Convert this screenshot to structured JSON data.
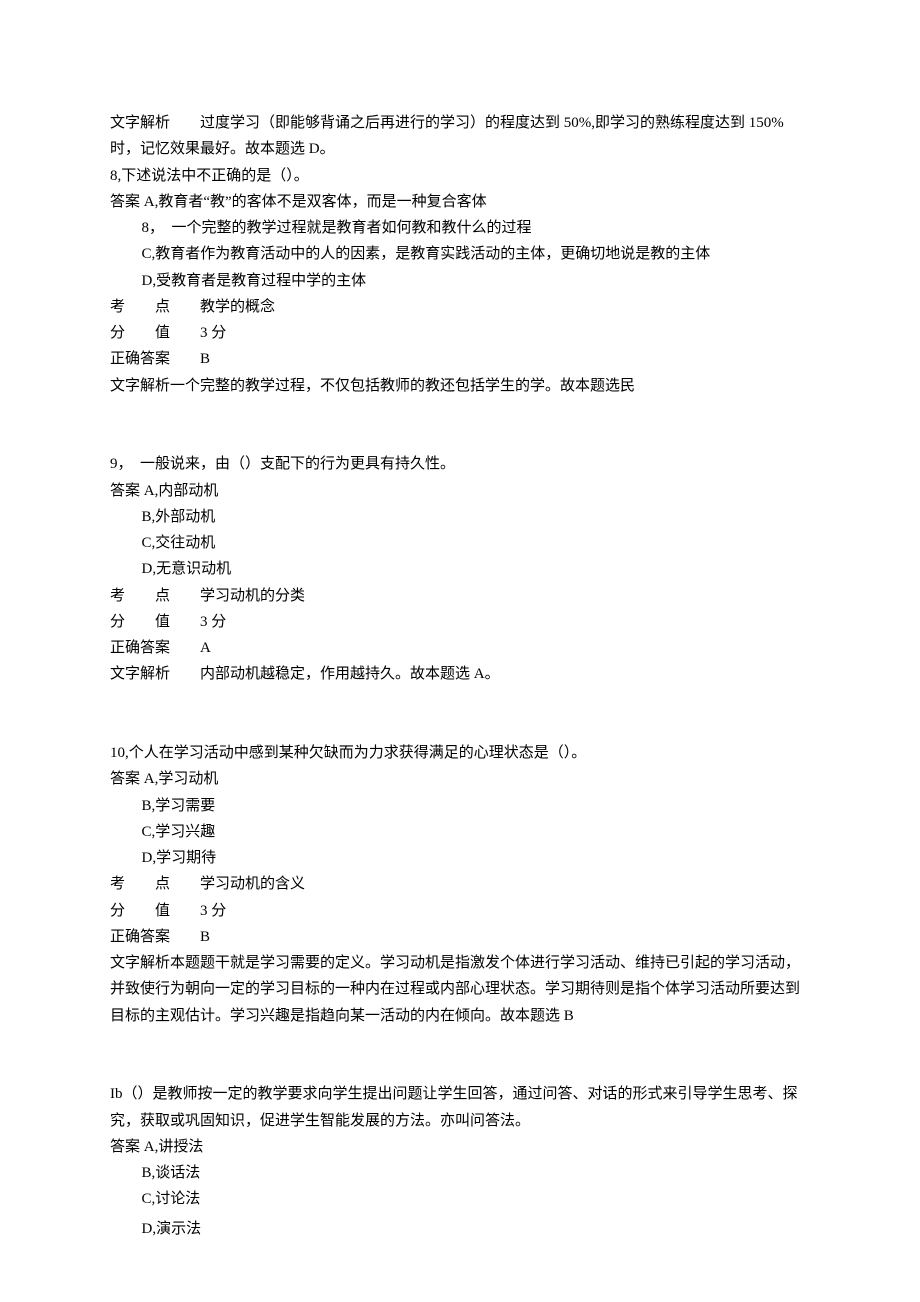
{
  "q7": {
    "explain_label": "文字解析",
    "explain_text": "　　过度学习（即能够背诵之后再进行的学习）的程度达到 50%,即学习的熟练程度达到 150%时，记忆效果最好。故本题选 D。"
  },
  "q8": {
    "num": "8,",
    "stem": "下述说法中不正确的是（）。",
    "opt_a_prefix": "答案 A,",
    "opt_a": "教育者“教”的客体不是双客体，而是一种复合客体",
    "opt_b_prefix": "8，",
    "opt_b": "一个完整的教学过程就是教育者如何教和教什么的过程",
    "opt_c_prefix": "C,",
    "opt_c": "教育者作为教育活动中的人的因素，是教育实践活动的主体，更确切地说是教的主体",
    "opt_d_prefix": "D,",
    "opt_d": "受教育者是教育过程中学的主体",
    "point_label": "考　　点",
    "point": "　　教学的概念",
    "score_label": "分　　值",
    "score": "　　3 分",
    "answer_label": "正确答案",
    "answer": "　　B",
    "explain_label": "文字解析",
    "explain": "一个完整的教学过程，不仅包括教师的教还包括学生的学。故本题选民"
  },
  "q9": {
    "num": "9，",
    "stem": "一般说来，由（）支配下的行为更具有持久性。",
    "opt_a_prefix": "答案 A,",
    "opt_a": "内部动机",
    "opt_b_prefix": "B,",
    "opt_b": "外部动机",
    "opt_c_prefix": "C,",
    "opt_c": "交往动机",
    "opt_d_prefix": "D,",
    "opt_d": "无意识动机",
    "point_label": "考　　点",
    "point": "　　学习动机的分类",
    "score_label": "分　　值",
    "score": "　　3 分",
    "answer_label": "正确答案",
    "answer": "　　A",
    "explain_label": "文字解析",
    "explain": "　　内部动机越稳定，作用越持久。故本题选 A。"
  },
  "q10": {
    "num": "10,",
    "stem": "个人在学习活动中感到某种欠缺而为力求获得满足的心理状态是（）。",
    "opt_a_prefix": "答案 A,",
    "opt_a": "学习动机",
    "opt_b_prefix": "B,",
    "opt_b": "学习需要",
    "opt_c_prefix": "C,",
    "opt_c": "学习兴趣",
    "opt_d_prefix": "D,",
    "opt_d": "学习期待",
    "point_label": "考　　点",
    "point": "　　学习动机的含义",
    "score_label": "分　　值",
    "score": "　　3 分",
    "answer_label": "正确答案",
    "answer": "　　B",
    "explain_label": "文字解析",
    "explain": "本题题干就是学习需要的定义。学习动机是指激发个体进行学习活动、维持已引起的学习活动，并致使行为朝向一定的学习目标的一种内在过程或内部心理状态。学习期待则是指个体学习活动所要达到目标的主观估计。学习兴趣是指趋向某一活动的内在倾向。故本题选 B"
  },
  "q11": {
    "num": "Ib",
    "stem": "（）是教师按一定的教学要求向学生提出问题让学生回答，通过问答、对话的形式来引导学生思考、探究，获取或巩固知识，促进学生智能发展的方法。亦叫问答法。",
    "opt_a_prefix": "答案 A,",
    "opt_a": "讲授法",
    "opt_b_prefix": "B,",
    "opt_b": "谈话法",
    "opt_c_prefix": "C,",
    "opt_c": "讨论法",
    "opt_d_prefix": "D,",
    "opt_d": "演示法"
  }
}
